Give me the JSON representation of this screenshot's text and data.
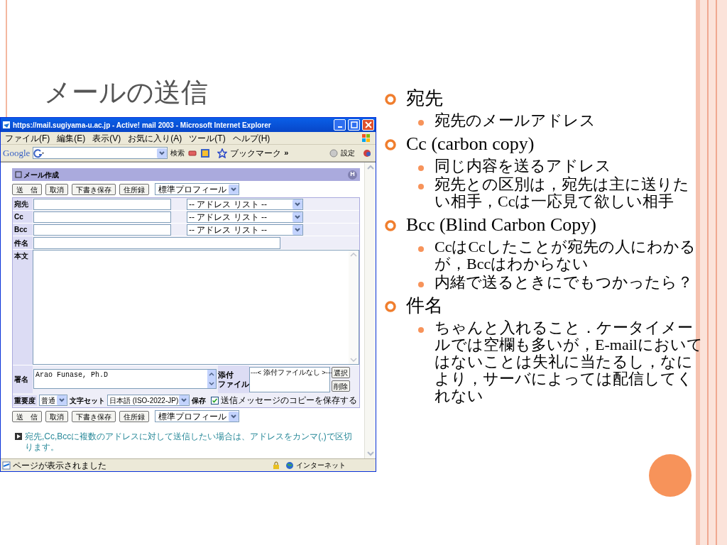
{
  "slide": {
    "title": "メールの送信"
  },
  "browser": {
    "title": "https://mail.sugiyama-u.ac.jp - Active! mail 2003 - Microsoft Internet Explorer",
    "menu": [
      "ファイル(F)",
      "編集(E)",
      "表示(V)",
      "お気に入り(A)",
      "ツール(T)",
      "ヘルプ(H)"
    ],
    "toolbar": {
      "logo": "Google",
      "search": "検索",
      "bookmarks": "ブックマーク",
      "more": "»",
      "settings": "設定"
    },
    "compose": {
      "heading": "メール作成",
      "help": "H",
      "buttons": [
        "送　信",
        "取消",
        "下書き保存",
        "住所録"
      ],
      "profile": "標準プロフィール",
      "address_rows": [
        {
          "label": "宛先",
          "address_list": "-- アドレス リスト --"
        },
        {
          "label": "Cc",
          "address_list": "-- アドレス リスト --"
        },
        {
          "label": "Bcc",
          "address_list": "-- アドレス リスト --"
        }
      ],
      "subject_label": "件名",
      "body_label": "本文",
      "signature_label": "署名",
      "signature": "Arao Funase, Ph.D",
      "attachment_label": [
        "添付",
        "ファイル"
      ],
      "attachments": "---< 添付ファイルなし >---",
      "attach_buttons": [
        "選択",
        "削除"
      ],
      "priority_label": "重要度",
      "priority": "普通",
      "charset_label": "文字セット",
      "charset": "日本語 (ISO-2022-JP)",
      "save_label": "保存",
      "save_copy": {
        "label": "送信メッセージのコピーを保存する",
        "checked": true
      },
      "bottom_buttons": [
        "送　信",
        "取消",
        "下書き保存",
        "住所録"
      ],
      "bottom_profile": "標準プロフィール",
      "note": "宛先,Cc,Bccに複数のアドレスに対して送信したい場合は、アドレスをカンマ(,)で区切ります。"
    },
    "status": {
      "text": "ページが表示されました",
      "zone": "インターネット"
    }
  },
  "bullets": [
    {
      "text": "宛先",
      "children": [
        {
          "text": "宛先のメールアドレス"
        }
      ]
    },
    {
      "text": "Cc (carbon copy)",
      "children": [
        {
          "text": "同じ内容を送るアドレス"
        },
        {
          "text": "宛先との区別は，宛先は主に送りたい相手，Ccは一応見て欲しい相手"
        }
      ]
    },
    {
      "text": "Bcc (Blind Carbon Copy)",
      "children": [
        {
          "text": "CcはCcしたことが宛先の人にわかるが，Bccはわからない"
        },
        {
          "text": "内緒で送るときにでもつかったら？"
        }
      ]
    },
    {
      "text": "件名",
      "children": [
        {
          "text": "ちゃんと入れること．ケータイメールでは空欄も多いが，E-mailにおいてはないことは失礼に当たるし，なにより，サーバによっては配信してくれない"
        }
      ]
    }
  ]
}
